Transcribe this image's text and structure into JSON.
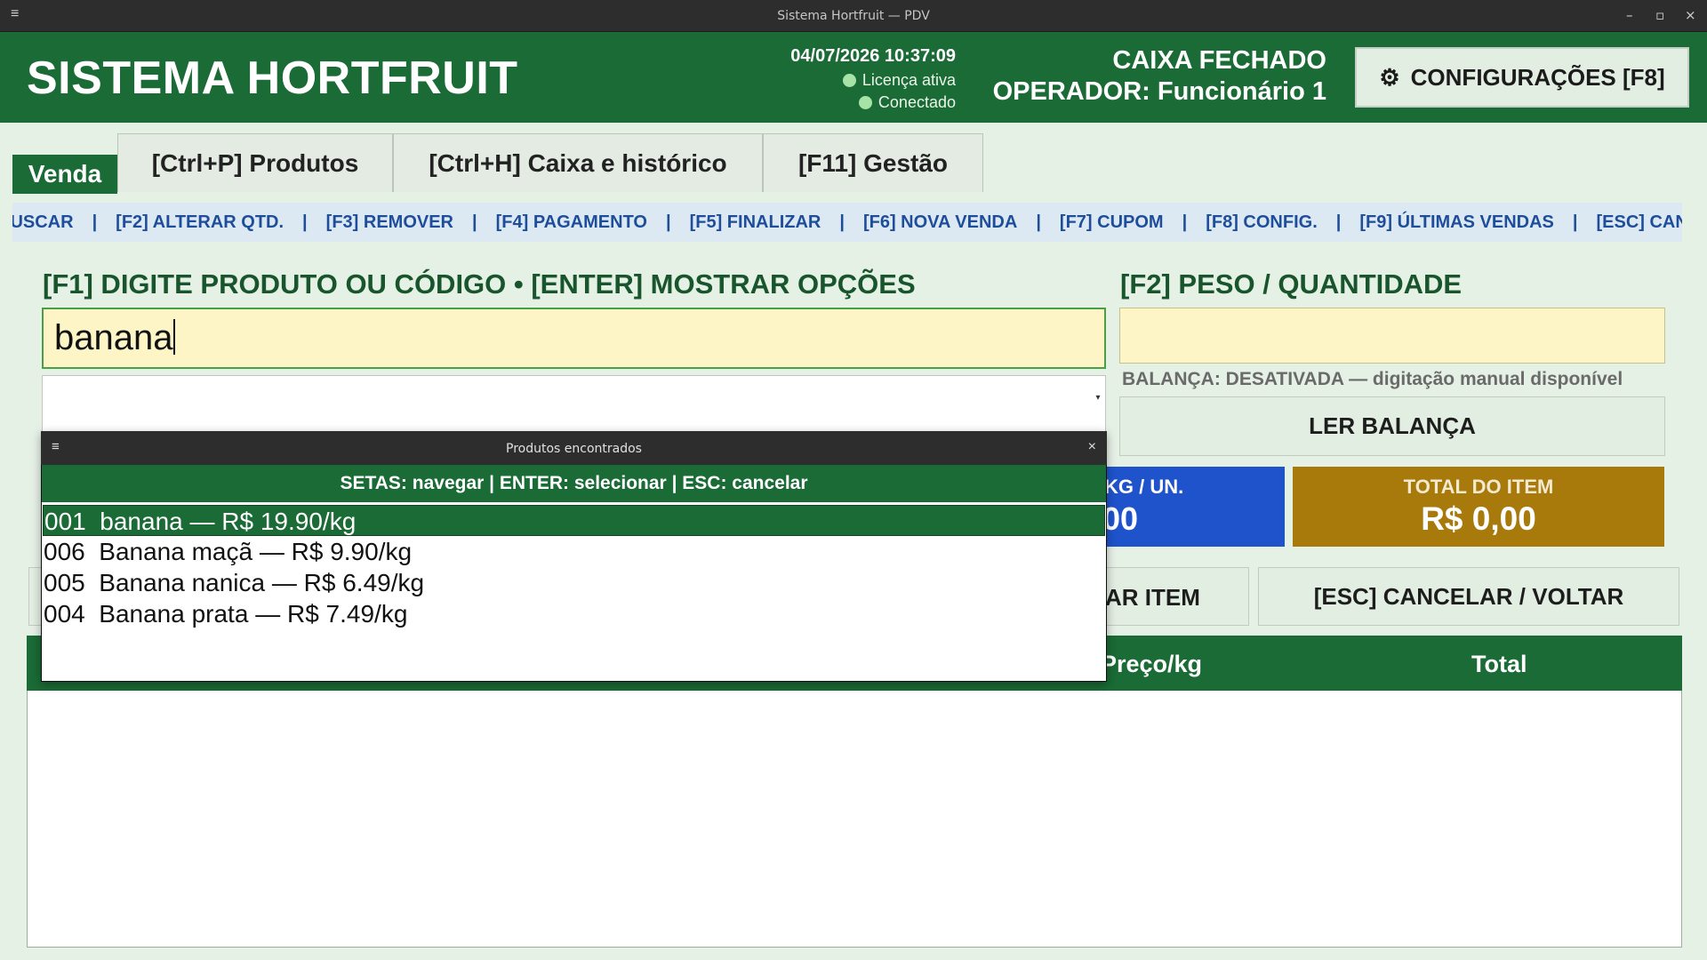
{
  "window": {
    "title": "Sistema Hortfruit — PDV",
    "menu_icon": "≡",
    "minimize": "–",
    "maximize": "▫",
    "close": "×"
  },
  "header": {
    "app_title": "SISTEMA HORTFRUIT",
    "datetime": "04/07/2026 10:37:09",
    "license_status": "Licença ativa",
    "connection_status": "Conectado",
    "caixa_status": "CAIXA FECHADO",
    "operador": "OPERADOR: Funcionário 1",
    "config_icon": "⚙",
    "config_label": "CONFIGURAÇÕES  [F8]",
    "status_dot_color": "#a6e3a6"
  },
  "tabs": [
    {
      "label": "Venda",
      "active": true
    },
    {
      "label": "[Ctrl+P] Produtos",
      "active": false
    },
    {
      "label": "[Ctrl+H] Caixa e histórico",
      "active": false
    },
    {
      "label": "[F11] Gestão",
      "active": false
    }
  ],
  "shortcuts": [
    "BUSCAR",
    "|",
    "[F2] ALTERAR QTD.",
    "|",
    "[F3] REMOVER",
    "|",
    "[F4] PAGAMENTO",
    "|",
    "[F5] FINALIZAR",
    "|",
    "[F6] NOVA VENDA",
    "|",
    "[F7] CUPOM",
    "|",
    "[F8] CONFIG.",
    "|",
    "[F9] ÚLTIMAS VENDAS",
    "|",
    "[ESC] CANCELAR"
  ],
  "product": {
    "label": "[F1] DIGITE PRODUTO OU CÓDIGO  •  [ENTER] MOSTRAR OPÇÕES",
    "value": "banana"
  },
  "weight": {
    "label": "[F2] PESO / QUANTIDADE",
    "value": "",
    "balanca_status": "BALANÇA: DESATIVADA — digitação manual disponível",
    "read_button": "LER BALANÇA"
  },
  "price_box": {
    "label": "KG / UN.",
    "value": "00",
    "color": "#1f53cc"
  },
  "total_box": {
    "label": "TOTAL DO ITEM",
    "value": "R$ 0,00",
    "color": "#a87a0b"
  },
  "buttons": {
    "add_item": "AR ITEM",
    "cancel": "[ESC] CANCELAR / VOLTAR"
  },
  "table": {
    "columns": [
      "Preço/kg",
      "Total"
    ],
    "rows": []
  },
  "popup": {
    "title": "Produtos encontrados",
    "hint": "SETAS: navegar   |   ENTER: selecionar   |   ESC: cancelar",
    "options": [
      {
        "text": "001  banana — R$ 19.90/kg",
        "selected": true
      },
      {
        "text": "006  Banana maçã — R$ 9.90/kg",
        "selected": false
      },
      {
        "text": "005  Banana nanica — R$ 6.49/kg",
        "selected": false
      },
      {
        "text": "004  Banana prata — R$ 7.49/kg",
        "selected": false
      }
    ]
  },
  "colors": {
    "primary_green": "#1a6b35",
    "input_yellow": "#fdf5c5",
    "shortcut_blue": "#1e4e9a"
  }
}
